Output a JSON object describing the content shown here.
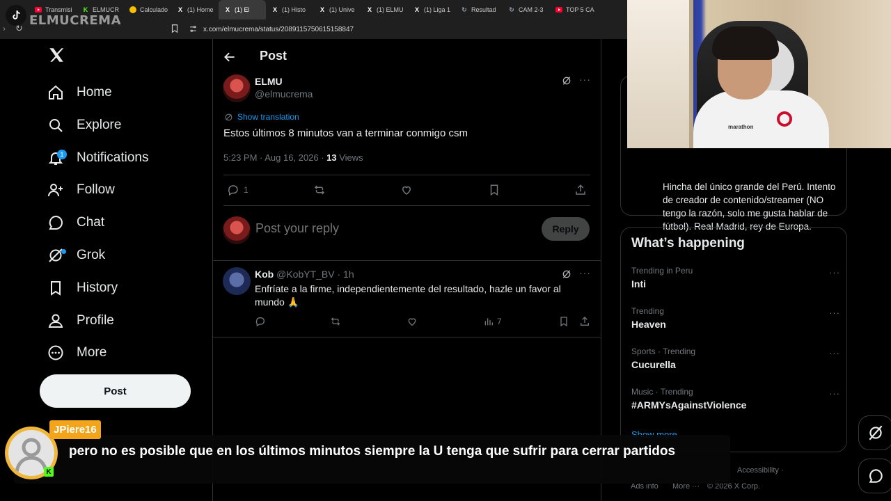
{
  "browser": {
    "tabs": [
      {
        "label": "Transmisi",
        "icon": "youtube-icon"
      },
      {
        "label": "ELMUCR",
        "icon": "kick-icon"
      },
      {
        "label": "Calculado",
        "icon": "calculator-icon"
      },
      {
        "label": "(1) Home",
        "icon": "x-icon"
      },
      {
        "label": "(1) El",
        "icon": "x-icon",
        "active": true
      },
      {
        "label": "(1) Histo",
        "icon": "x-icon"
      },
      {
        "label": "(1) Unive",
        "icon": "x-icon"
      },
      {
        "label": "(1) ELMU",
        "icon": "x-icon"
      },
      {
        "label": "(1) Liga 1",
        "icon": "x-icon"
      },
      {
        "label": "Resultad",
        "icon": "refresh-icon"
      },
      {
        "label": "CAM 2-3",
        "icon": "refresh-icon"
      },
      {
        "label": "TOP 5 CA",
        "icon": "youtube-icon"
      }
    ],
    "url": "x.com/elmucrema/status/2089115750615158847"
  },
  "watermark": {
    "text": "ELMUCREMA"
  },
  "nav": {
    "items": [
      {
        "label": "Home",
        "icon": "home-icon"
      },
      {
        "label": "Explore",
        "icon": "search-icon"
      },
      {
        "label": "Notifications",
        "icon": "bell-icon",
        "badge": "1"
      },
      {
        "label": "Follow",
        "icon": "follow-icon"
      },
      {
        "label": "Chat",
        "icon": "chat-icon"
      },
      {
        "label": "Grok",
        "icon": "grok-icon"
      },
      {
        "label": "History",
        "icon": "bookmark-icon"
      },
      {
        "label": "Profile",
        "icon": "person-icon"
      },
      {
        "label": "More",
        "icon": "more-circle-icon"
      }
    ],
    "post_label": "Post"
  },
  "header": {
    "title": "Post"
  },
  "post": {
    "name": "ELMU",
    "handle": "@elmucrema",
    "translate": "Show translation",
    "text": "Estos últimos 8 minutos van a terminar conmigo csm",
    "time": "5:23 PM · Aug 16, 2026 · ",
    "views_count": "13",
    "views_label": " Views",
    "reply_count": "1"
  },
  "reply_box": {
    "placeholder": "Post your reply",
    "button": "Reply"
  },
  "reply": {
    "name": "Kob",
    "handle": "@KobYT_BV",
    "time": "· 1h",
    "text": "Enfríate a la firme, independientemente del resultado, hazle un favor al mundo 🙏",
    "views": "7"
  },
  "sidebar": {
    "bio": "Hincha del único grande del Perú. Intento de creador de contenido/streamer (NO tengo la razón, solo me gusta hablar de fútbol). Real Madrid, rey de Europa.",
    "happening_title": "What’s happening",
    "trends": [
      {
        "context": "Trending in Peru",
        "name": "Inti"
      },
      {
        "context": "Trending",
        "name": "Heaven"
      },
      {
        "context": "Sports · Trending",
        "name": "Cucurella"
      },
      {
        "context": "Music · Trending",
        "name": "#ARMYsAgainstViolence"
      }
    ],
    "show_more": "Show more",
    "footer_line1": "Accessibility ·",
    "footer_ads": "Ads info",
    "footer_more": "More ···",
    "footer_copy": "© 2026 X Corp."
  },
  "chat": {
    "username": "JPiere16",
    "message": "pero no es posible que en los últimos minutos siempre la U tenga que sufrir para cerrar partidos"
  },
  "webcam": {
    "shirt_text": "marathon"
  },
  "colors": {
    "accent": "#1d9bf0",
    "background": "#000000",
    "chat_tag": "#f2a51a",
    "kick": "#53fc18"
  }
}
